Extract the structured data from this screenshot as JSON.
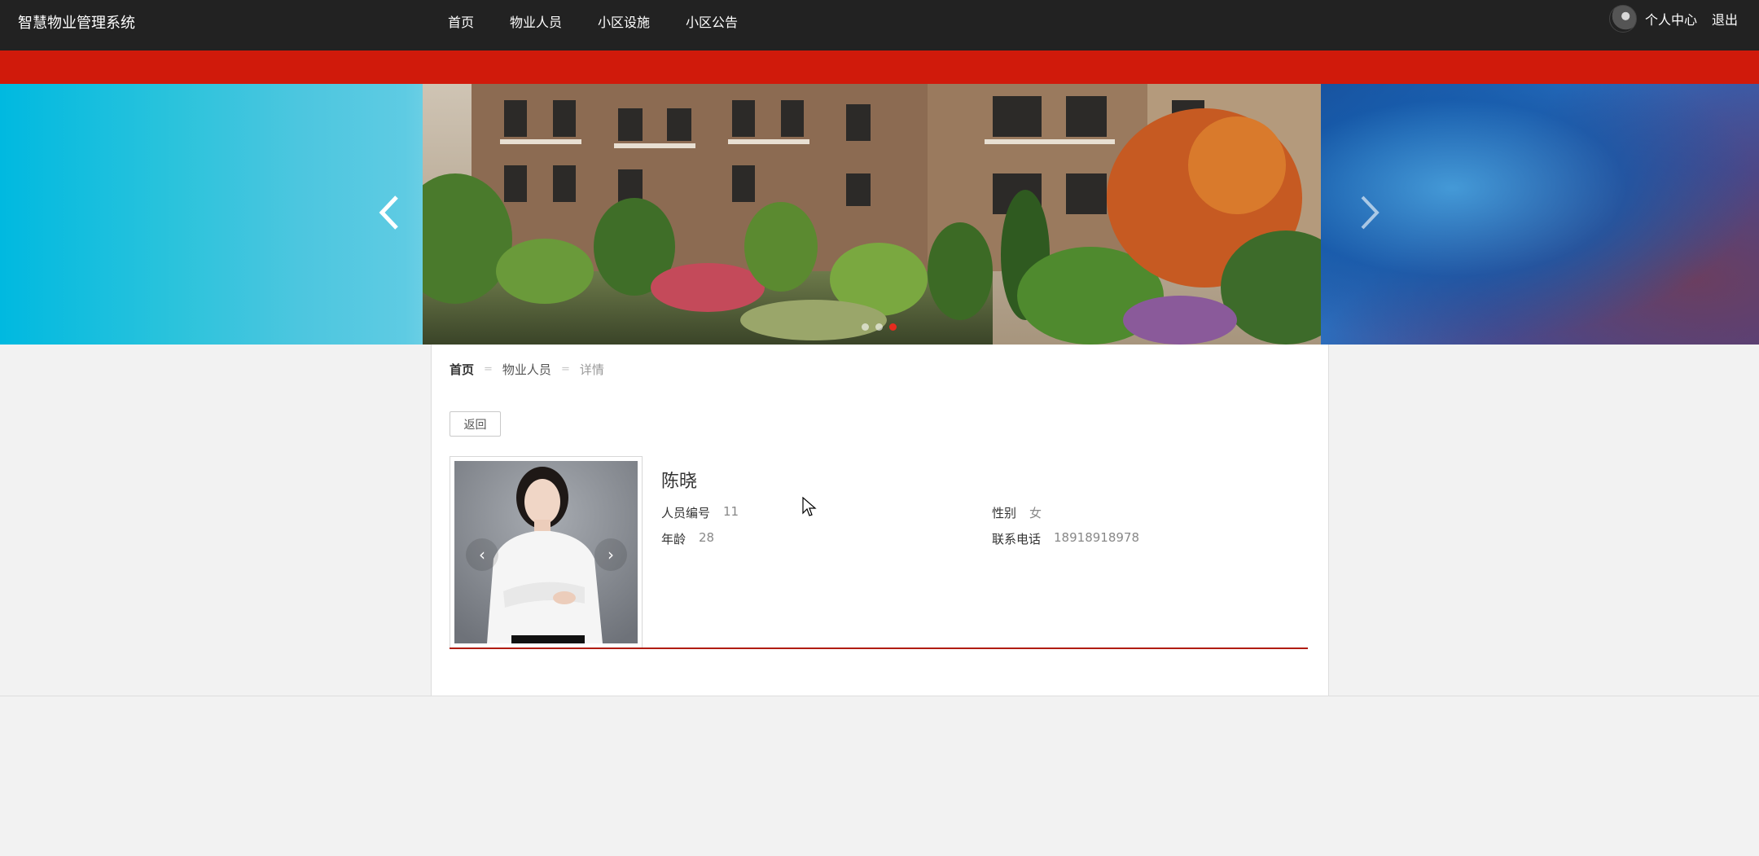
{
  "app": {
    "title": "智慧物业管理系统"
  },
  "nav": {
    "items": [
      {
        "label": "首页"
      },
      {
        "label": "物业人员"
      },
      {
        "label": "小区设施"
      },
      {
        "label": "小区公告"
      }
    ]
  },
  "user": {
    "center_label": "个人中心",
    "logout_label": "退出"
  },
  "carousel": {
    "dot_count": 3,
    "active_index": 2
  },
  "breadcrumb": {
    "home": "首页",
    "separator": "=",
    "section": "物业人员",
    "current": "详情"
  },
  "detail": {
    "back_label": "返回",
    "name": "陈晓",
    "fields": {
      "id": {
        "label": "人员编号",
        "value": "11"
      },
      "gender": {
        "label": "性别",
        "value": "女"
      },
      "age": {
        "label": "年龄",
        "value": "28"
      },
      "phone": {
        "label": "联系电话",
        "value": "18918918978"
      }
    },
    "photo_prev": "‹",
    "photo_next": "›"
  },
  "colors": {
    "topbar": "#222222",
    "accent_red": "#d01a0b",
    "underline_red": "#b01c10",
    "page_bg": "#f2f2f2"
  }
}
